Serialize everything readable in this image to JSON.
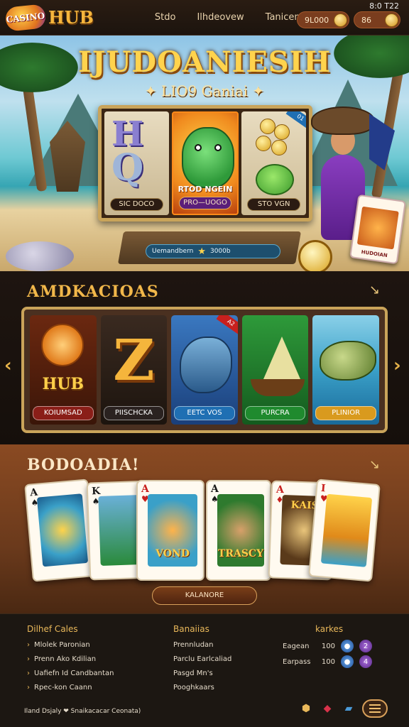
{
  "header": {
    "logo_badge": "CASINO",
    "logo_text": "HUB",
    "nav": [
      "Stdo",
      "Ilhdeovew",
      "Tanicen"
    ],
    "balance1": "9L000",
    "balance2": "86",
    "status_time": "8:0 T22"
  },
  "hero": {
    "title": "IJUDOANIESIH",
    "subtitle": "LIO9 Ganiai",
    "reels": [
      {
        "label": "SIC DOCO"
      },
      {
        "label": "PRO—UOGO",
        "header": "RTOD NGEIN"
      },
      {
        "label": "STO VGN"
      }
    ],
    "corner_tag": "01",
    "banner_text": "Uemandbern",
    "banner_amount": "3000b",
    "card_caption": "HUDOIAN"
  },
  "featured": {
    "title": "AMDKACIOAS",
    "tiles": [
      {
        "label": "KOIUMSAD",
        "art": "HUB"
      },
      {
        "label": "PIISCHCKA",
        "art": "Z"
      },
      {
        "label": "EETC VOS",
        "tag": "A2"
      },
      {
        "label": "PURCRA"
      },
      {
        "label": "PLINIOR"
      }
    ]
  },
  "cards_section": {
    "title": "BODOADIA!",
    "cards": [
      {
        "rank": "A",
        "suit": "♠",
        "color": "black"
      },
      {
        "rank": "K",
        "suit": "♠",
        "color": "black"
      },
      {
        "rank": "A",
        "suit": "♥",
        "color": "red",
        "caption": "VOND"
      },
      {
        "rank": "A",
        "suit": "♠",
        "color": "black",
        "caption": "TRASCY"
      },
      {
        "rank": "A",
        "suit": "♦",
        "color": "red",
        "caption": "KAIS"
      },
      {
        "rank": "I",
        "suit": "♥",
        "color": "red"
      }
    ],
    "button_label": "KALANORE"
  },
  "footer": {
    "col1_title": "Dilhef Cales",
    "col1_items": [
      "Mlolek Paronian",
      "Prenn Ako Kdilian",
      "Uafiefn Id Candbantan",
      "Rpec-kon Caann"
    ],
    "col2_title": "Banaiias",
    "col2_items": [
      "Prennludan",
      "Parclu Earlcaliad",
      "Pasgd Mn's",
      "Pooghkaars"
    ],
    "col3_title": "karkes",
    "ranks": [
      {
        "name": "Eagean",
        "num": "100",
        "badge": "2"
      },
      {
        "name": "Earpass",
        "num": "100",
        "badge": "4"
      }
    ],
    "copyright": "Iland Dsjaly ❤ Snaikacacar Ceonata)"
  }
}
